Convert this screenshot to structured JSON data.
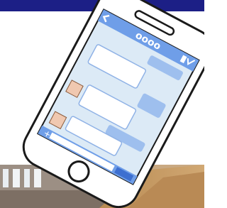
{
  "header": {
    "bar_color": "#1c1f86"
  },
  "phone": {
    "status_dots": "oooo",
    "body_color": "#ffffff",
    "screen_color": "#dceaf6",
    "bubble_light": "#ffffff",
    "bubble_blue": "#9ebfee",
    "header_color": "#6f9ee8"
  },
  "icons": {
    "back": "chevron-left-icon",
    "signal": "signal-bars-icon",
    "battery": "battery-icon",
    "add": "plus-icon"
  }
}
